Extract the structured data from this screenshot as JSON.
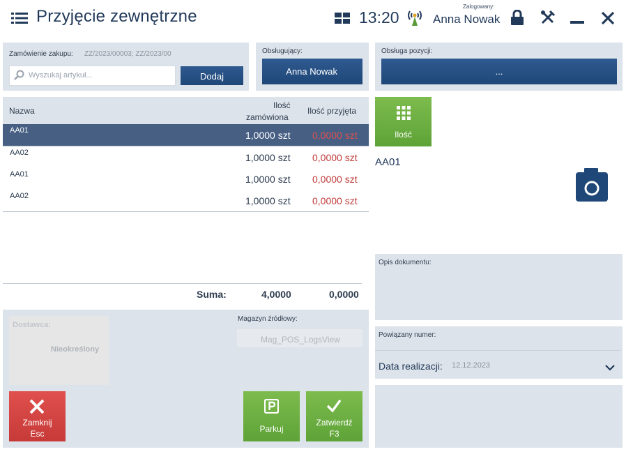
{
  "header": {
    "title": "Przyjęcie zewnętrzne",
    "time": "13:20",
    "logged_caption": "Zalogowany:",
    "user": "Anna Nowak"
  },
  "order": {
    "caption": "Zamówienie zakupu:",
    "numbers": "ZZ/2023/00003; ZZ/2023/00",
    "search_placeholder": "Wyszukaj artykuł...",
    "add_label": "Dodaj"
  },
  "operator": {
    "caption": "Obsługujący:",
    "value": "Anna Nowak"
  },
  "item_handling": {
    "caption": "Obsługa pozycji:",
    "value": "..."
  },
  "table": {
    "headers": {
      "name": "Nazwa",
      "ordered_line1": "Ilość",
      "ordered_line2": "zamówiona",
      "received": "Ilość przyjęta"
    },
    "rows": [
      {
        "name": "AA01",
        "ordered": "1,0000 szt",
        "received": "0,0000 szt",
        "selected": true
      },
      {
        "name": "AA02",
        "ordered": "1,0000 szt",
        "received": "0,0000 szt",
        "selected": false
      },
      {
        "name": "AA01",
        "ordered": "1,0000 szt",
        "received": "0,0000 szt",
        "selected": false
      },
      {
        "name": "AA02",
        "ordered": "1,0000 szt",
        "received": "0,0000 szt",
        "selected": false
      }
    ],
    "sum_label": "Suma:",
    "sum_ordered": "4,0000",
    "sum_received": "0,0000"
  },
  "quantity_button": "Ilość",
  "selected_item": "AA01",
  "document_description_caption": "Opis dokumentu:",
  "supplier": {
    "caption": "Dostawca:",
    "value": "Nieokreślony"
  },
  "source_warehouse": {
    "caption": "Magazyn źródłowy:",
    "value": "Mag_POS_LogsView"
  },
  "related_number_caption": "Powiązany numer:",
  "realization_date": {
    "label": "Data realizacji:",
    "value": "12.12.2023"
  },
  "buttons": {
    "close_line1": "Zamknij",
    "close_line2": "Esc",
    "park": "Parkuj",
    "confirm_line1": "Zatwierdź",
    "confirm_line2": "F3"
  },
  "colors": {
    "accent_blue": "#1f4778",
    "selected_row": "#465f83",
    "green_button": "#6aab3f",
    "red_button": "#d14643",
    "panel": "#dde3ea",
    "received_text": "#c03a38"
  },
  "icons": [
    "menu-icon",
    "layout-grid-icon",
    "signal-icon",
    "lock-icon",
    "tools-icon",
    "minimize-icon",
    "close-icon",
    "search-icon",
    "keypad-icon",
    "camera-icon",
    "close-x-icon",
    "parking-icon",
    "checkmark-icon",
    "chevron-down-icon"
  ]
}
